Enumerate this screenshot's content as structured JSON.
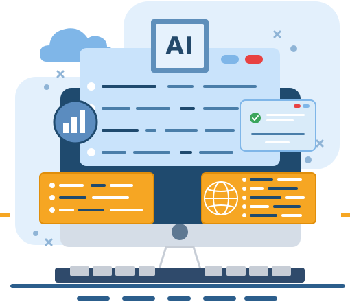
{
  "illustration": {
    "badge_text": "AI",
    "colors": {
      "navy": "#1f4a6e",
      "dark_navy": "#1e3a5f",
      "light_blue": "#c9e3fb",
      "pale_blue": "#e4f1fc",
      "mid_blue": "#7fb6e8",
      "orange": "#f6a623",
      "orange_dark": "#e08e0b",
      "red": "#e84242",
      "green": "#3ba55c",
      "gray": "#c7cdd6"
    },
    "icons": [
      "cloud-icon",
      "bar-chart-icon",
      "globe-icon",
      "check-icon",
      "sparkle-icon"
    ]
  }
}
